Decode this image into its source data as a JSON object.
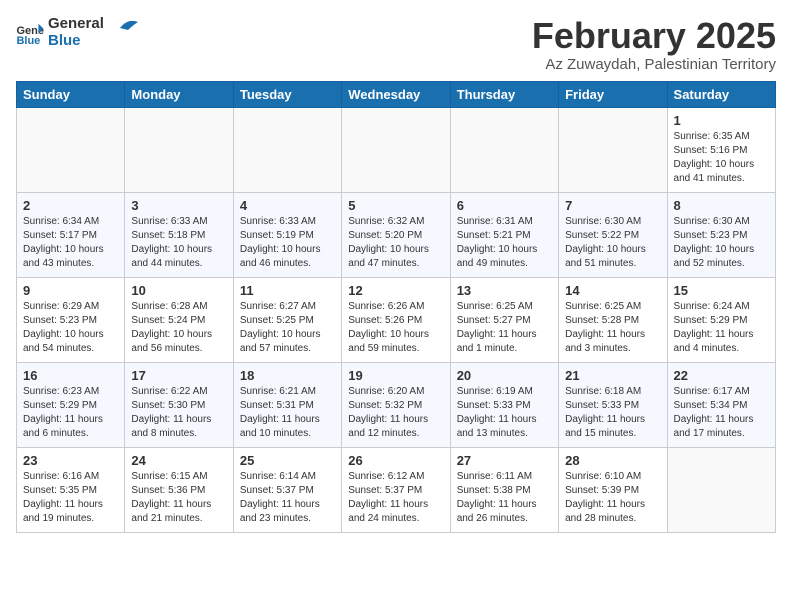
{
  "header": {
    "logo": {
      "general": "General",
      "blue": "Blue"
    },
    "title": "February 2025",
    "subtitle": "Az Zuwaydah, Palestinian Territory"
  },
  "days_of_week": [
    "Sunday",
    "Monday",
    "Tuesday",
    "Wednesday",
    "Thursday",
    "Friday",
    "Saturday"
  ],
  "weeks": [
    [
      {
        "day": "",
        "info": ""
      },
      {
        "day": "",
        "info": ""
      },
      {
        "day": "",
        "info": ""
      },
      {
        "day": "",
        "info": ""
      },
      {
        "day": "",
        "info": ""
      },
      {
        "day": "",
        "info": ""
      },
      {
        "day": "1",
        "info": "Sunrise: 6:35 AM\nSunset: 5:16 PM\nDaylight: 10 hours and 41 minutes."
      }
    ],
    [
      {
        "day": "2",
        "info": "Sunrise: 6:34 AM\nSunset: 5:17 PM\nDaylight: 10 hours and 43 minutes."
      },
      {
        "day": "3",
        "info": "Sunrise: 6:33 AM\nSunset: 5:18 PM\nDaylight: 10 hours and 44 minutes."
      },
      {
        "day": "4",
        "info": "Sunrise: 6:33 AM\nSunset: 5:19 PM\nDaylight: 10 hours and 46 minutes."
      },
      {
        "day": "5",
        "info": "Sunrise: 6:32 AM\nSunset: 5:20 PM\nDaylight: 10 hours and 47 minutes."
      },
      {
        "day": "6",
        "info": "Sunrise: 6:31 AM\nSunset: 5:21 PM\nDaylight: 10 hours and 49 minutes."
      },
      {
        "day": "7",
        "info": "Sunrise: 6:30 AM\nSunset: 5:22 PM\nDaylight: 10 hours and 51 minutes."
      },
      {
        "day": "8",
        "info": "Sunrise: 6:30 AM\nSunset: 5:23 PM\nDaylight: 10 hours and 52 minutes."
      }
    ],
    [
      {
        "day": "9",
        "info": "Sunrise: 6:29 AM\nSunset: 5:23 PM\nDaylight: 10 hours and 54 minutes."
      },
      {
        "day": "10",
        "info": "Sunrise: 6:28 AM\nSunset: 5:24 PM\nDaylight: 10 hours and 56 minutes."
      },
      {
        "day": "11",
        "info": "Sunrise: 6:27 AM\nSunset: 5:25 PM\nDaylight: 10 hours and 57 minutes."
      },
      {
        "day": "12",
        "info": "Sunrise: 6:26 AM\nSunset: 5:26 PM\nDaylight: 10 hours and 59 minutes."
      },
      {
        "day": "13",
        "info": "Sunrise: 6:25 AM\nSunset: 5:27 PM\nDaylight: 11 hours and 1 minute."
      },
      {
        "day": "14",
        "info": "Sunrise: 6:25 AM\nSunset: 5:28 PM\nDaylight: 11 hours and 3 minutes."
      },
      {
        "day": "15",
        "info": "Sunrise: 6:24 AM\nSunset: 5:29 PM\nDaylight: 11 hours and 4 minutes."
      }
    ],
    [
      {
        "day": "16",
        "info": "Sunrise: 6:23 AM\nSunset: 5:29 PM\nDaylight: 11 hours and 6 minutes."
      },
      {
        "day": "17",
        "info": "Sunrise: 6:22 AM\nSunset: 5:30 PM\nDaylight: 11 hours and 8 minutes."
      },
      {
        "day": "18",
        "info": "Sunrise: 6:21 AM\nSunset: 5:31 PM\nDaylight: 11 hours and 10 minutes."
      },
      {
        "day": "19",
        "info": "Sunrise: 6:20 AM\nSunset: 5:32 PM\nDaylight: 11 hours and 12 minutes."
      },
      {
        "day": "20",
        "info": "Sunrise: 6:19 AM\nSunset: 5:33 PM\nDaylight: 11 hours and 13 minutes."
      },
      {
        "day": "21",
        "info": "Sunrise: 6:18 AM\nSunset: 5:33 PM\nDaylight: 11 hours and 15 minutes."
      },
      {
        "day": "22",
        "info": "Sunrise: 6:17 AM\nSunset: 5:34 PM\nDaylight: 11 hours and 17 minutes."
      }
    ],
    [
      {
        "day": "23",
        "info": "Sunrise: 6:16 AM\nSunset: 5:35 PM\nDaylight: 11 hours and 19 minutes."
      },
      {
        "day": "24",
        "info": "Sunrise: 6:15 AM\nSunset: 5:36 PM\nDaylight: 11 hours and 21 minutes."
      },
      {
        "day": "25",
        "info": "Sunrise: 6:14 AM\nSunset: 5:37 PM\nDaylight: 11 hours and 23 minutes."
      },
      {
        "day": "26",
        "info": "Sunrise: 6:12 AM\nSunset: 5:37 PM\nDaylight: 11 hours and 24 minutes."
      },
      {
        "day": "27",
        "info": "Sunrise: 6:11 AM\nSunset: 5:38 PM\nDaylight: 11 hours and 26 minutes."
      },
      {
        "day": "28",
        "info": "Sunrise: 6:10 AM\nSunset: 5:39 PM\nDaylight: 11 hours and 28 minutes."
      },
      {
        "day": "",
        "info": ""
      }
    ]
  ]
}
